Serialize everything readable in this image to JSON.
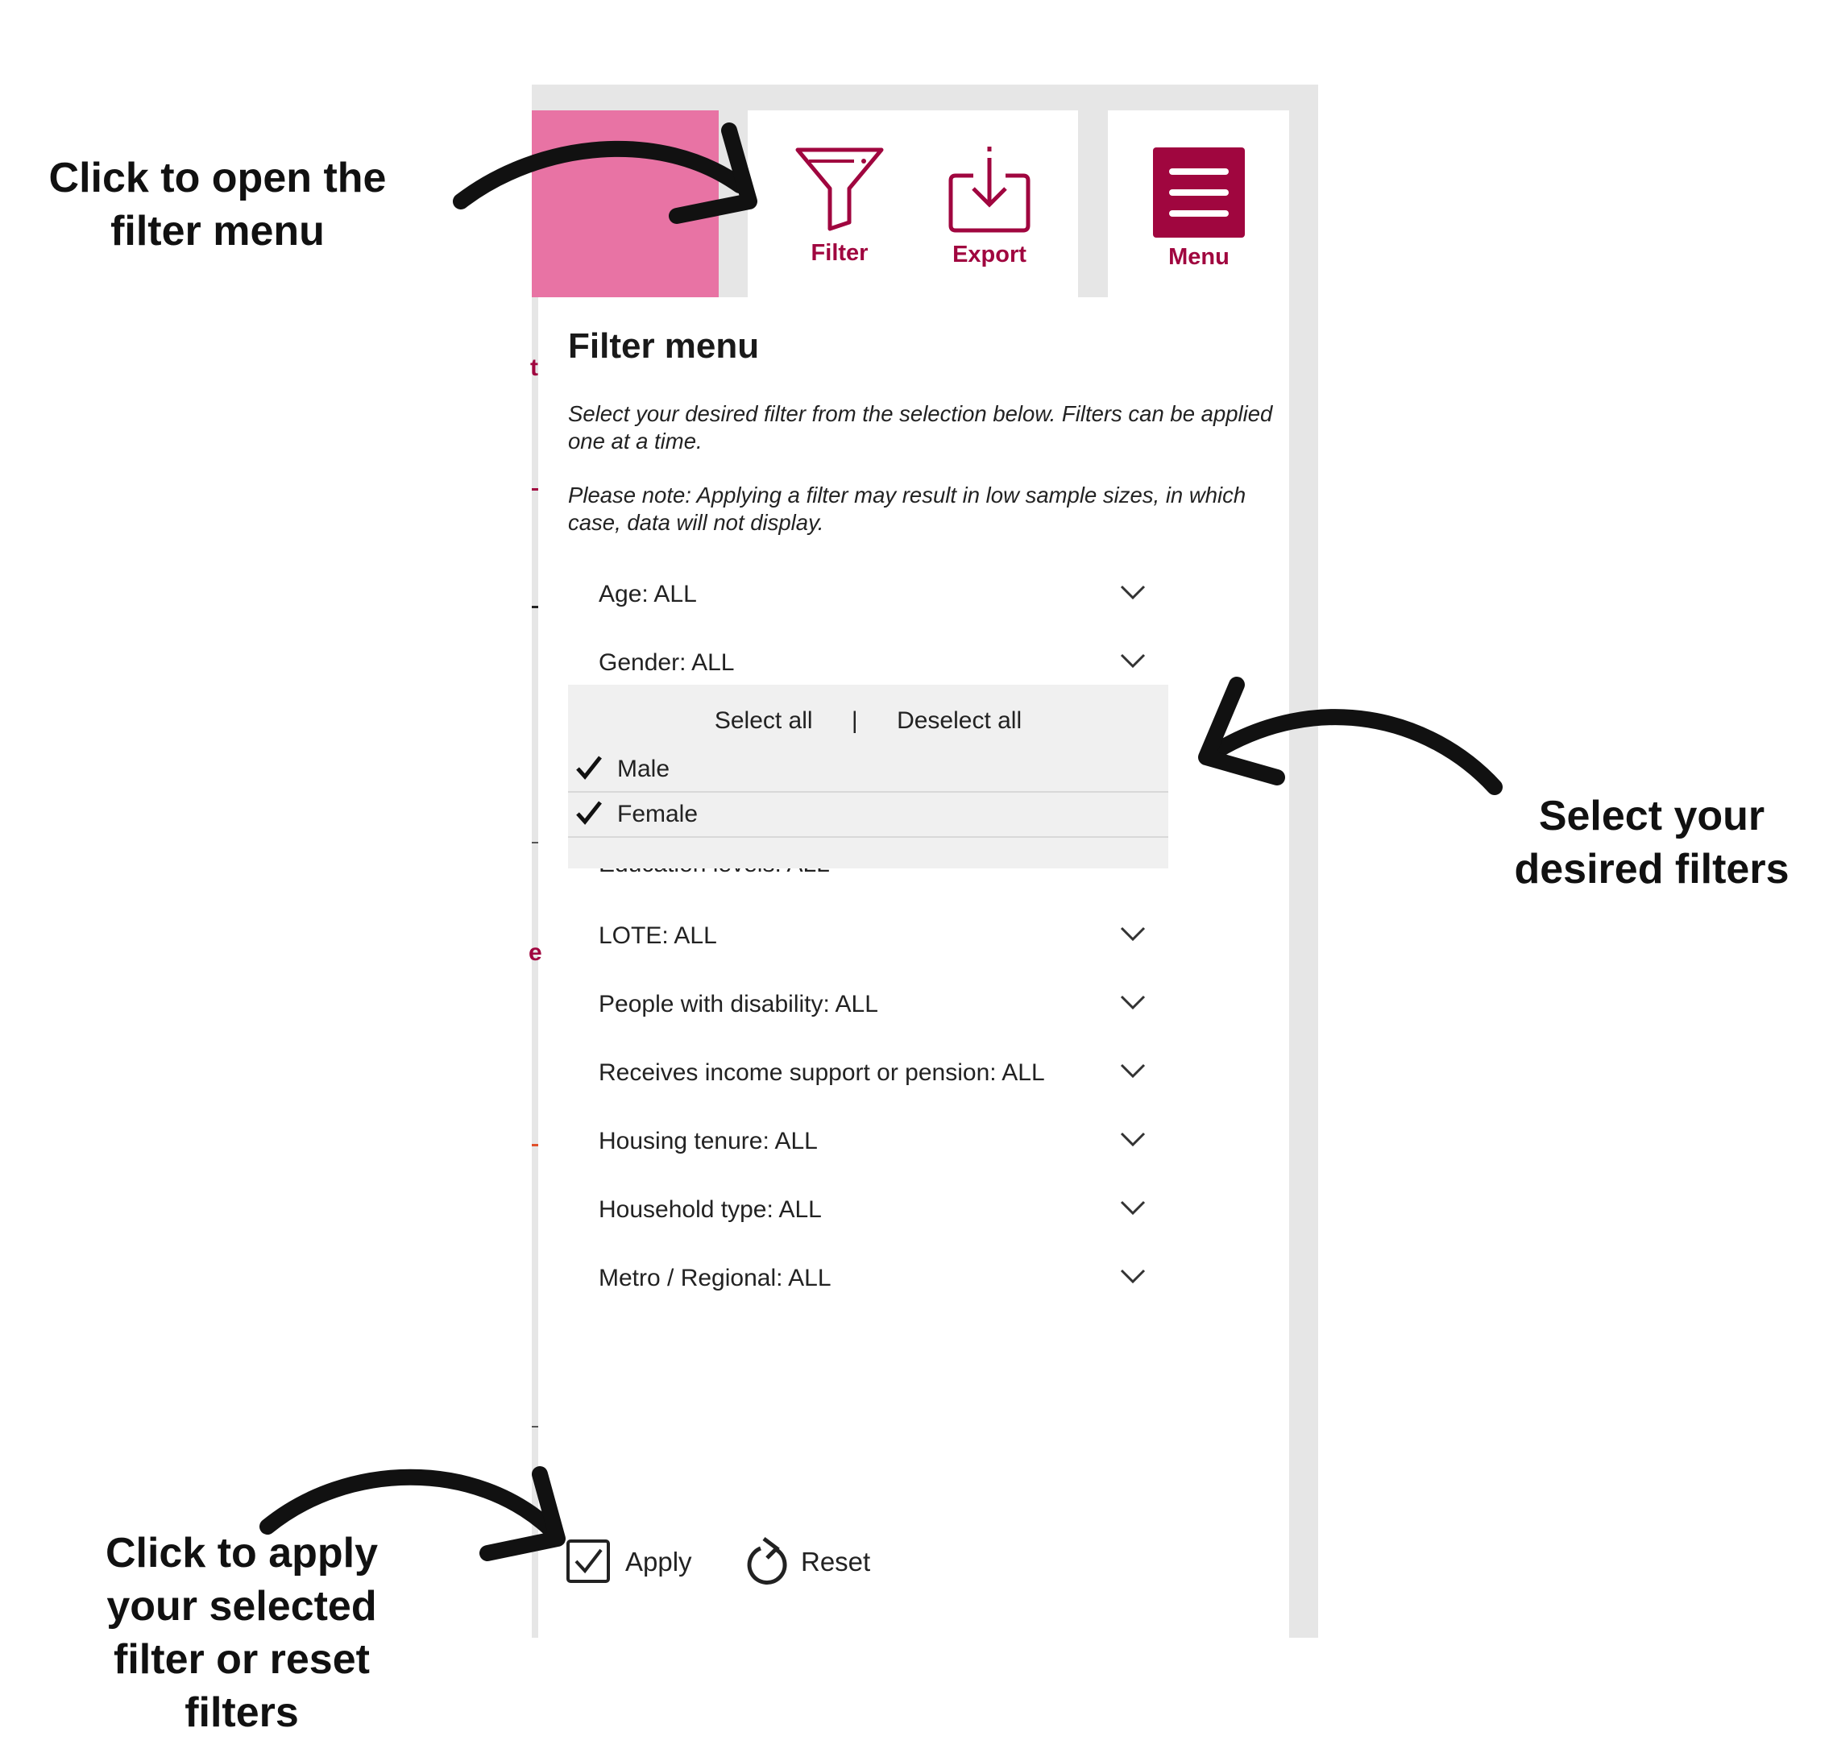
{
  "toolbar": {
    "filter_label": "Filter",
    "export_label": "Export",
    "menu_label": "Menu"
  },
  "panel": {
    "title": "Filter menu",
    "intro": "Select your desired filter from the selection below. Filters can be applied one at a time.",
    "note": "Please note: Applying a filter may result in low sample sizes, in which case, data will not display."
  },
  "filters": [
    {
      "label": "Age: ALL"
    },
    {
      "label": "Gender: ALL"
    },
    {
      "label": "Education levels: ALL"
    },
    {
      "label": "LOTE: ALL"
    },
    {
      "label": "People with disability: ALL"
    },
    {
      "label": "Receives income support or pension: ALL"
    },
    {
      "label": "Housing tenure: ALL"
    },
    {
      "label": "Household type: ALL"
    },
    {
      "label": "Metro / Regional: ALL"
    }
  ],
  "dropdown": {
    "select_all": "Select all",
    "separator": "|",
    "deselect_all": "Deselect all",
    "options": [
      {
        "label": "Male",
        "checked": true
      },
      {
        "label": "Female",
        "checked": true
      }
    ]
  },
  "actions": {
    "apply": "Apply",
    "reset": "Reset"
  },
  "annotations": {
    "open_filter": "Click to open the filter menu",
    "select_filters": "Select your desired filters",
    "apply_reset": "Click to apply your selected filter or reset filters"
  },
  "colors": {
    "brand": "#a0063f",
    "pink_tile": "#e873a4",
    "frame": "#e6e6e6",
    "dropdown_bg": "#f0f0f0"
  }
}
